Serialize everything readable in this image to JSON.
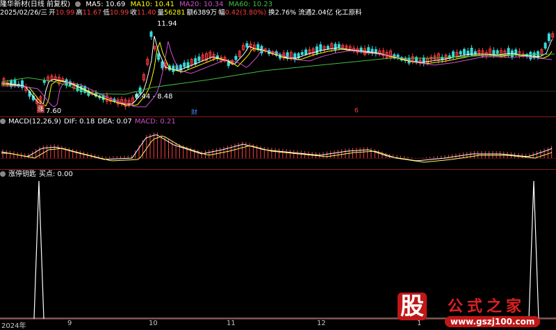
{
  "colors": {
    "up": "#ff3c3c",
    "down": "#38d8d8",
    "ma5": "#ffffff",
    "ma10": "#ffff00",
    "ma20": "#d050d0",
    "ma60": "#40c040",
    "grid": "#8a1d1d",
    "hist": "#ff4040"
  },
  "header": {
    "stock": "隆华新材(日线 前复权)",
    "ma5": "MA5: 10.69",
    "ma10": "MA10: 10.41",
    "ma20": "MA20: 10.34",
    "ma60": "MA60: 10.23",
    "date": "2025/02/26/三",
    "open_label": "开",
    "open": "10.99",
    "high_label": "高",
    "high": "11.67",
    "low_label": "低",
    "low": "10.99",
    "close_label": "收",
    "close": "11.40",
    "vol_label": "量",
    "vol": "56281",
    "amt_label": "额",
    "amt": "6389万",
    "chg_label": "幅",
    "chg": "0.42(3.80%)",
    "turnover": "换2.76%",
    "float": "流通2.04亿",
    "industry": "化工原料"
  },
  "annotations": {
    "high_price": "11.94",
    "low_price": "7.60",
    "range": "8.44 - 8.48",
    "tag_zhang": "涨",
    "tag_cai": "财",
    "tag_shao": "6"
  },
  "macd": {
    "label": "MACD(12,26,9)",
    "dif": "DIF: 0.18",
    "dea": "DEA: 0.07",
    "macd": "MACD: 0.21"
  },
  "indicator": {
    "label": "涨停钥匙",
    "buy": "买点: 0.00",
    "icon": "gear-icon"
  },
  "xaxis": {
    "ticks": [
      "2024年",
      "9",
      "10",
      "11",
      "12",
      "1"
    ]
  },
  "watermark": {
    "logo_char": "股",
    "text": "公式之家",
    "url": "www.gszj100.com"
  }
}
